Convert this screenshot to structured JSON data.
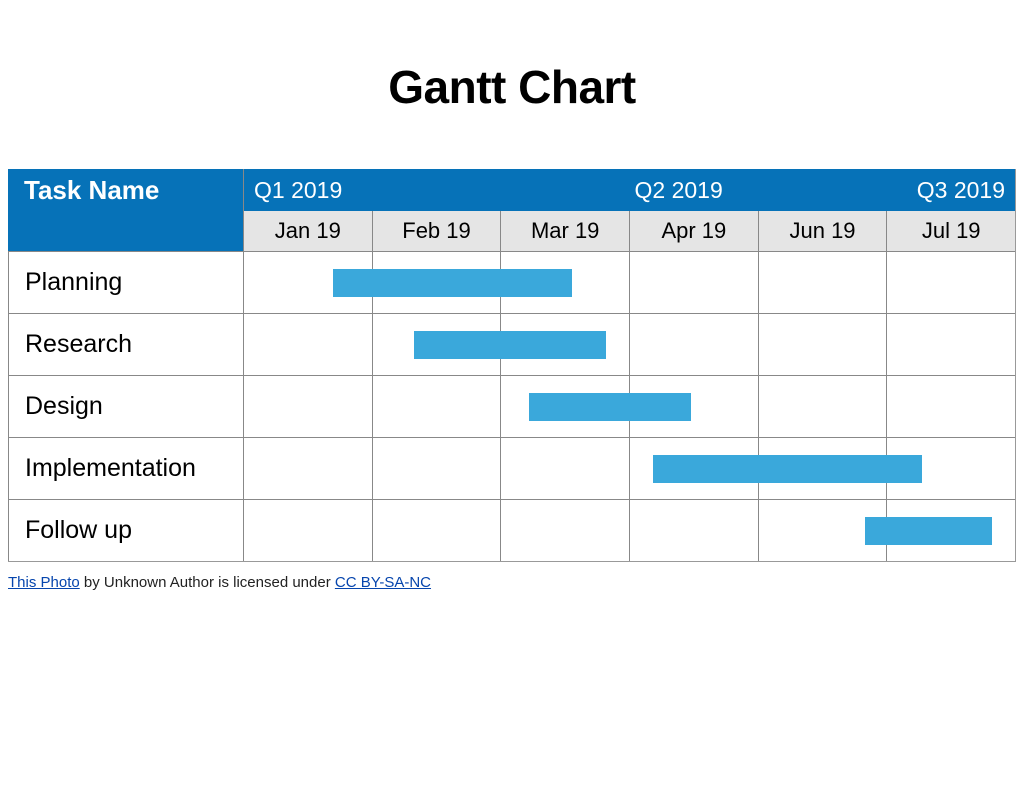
{
  "title": "Gantt Chart",
  "task_header": "Task Name",
  "quarters": [
    "Q1 2019",
    "Q2 2019",
    "Q3 2019"
  ],
  "months": [
    "Jan 19",
    "Feb 19",
    "Mar 19",
    "Apr 19",
    "Jun 19",
    "Jul 19"
  ],
  "tasks": [
    {
      "name": "Planning",
      "start_pct": 11.5,
      "width_pct": 31
    },
    {
      "name": "Research",
      "start_pct": 22,
      "width_pct": 25
    },
    {
      "name": "Design",
      "start_pct": 37,
      "width_pct": 21
    },
    {
      "name": "Implementation",
      "start_pct": 53,
      "width_pct": 35
    },
    {
      "name": "Follow up",
      "start_pct": 80.5,
      "width_pct": 16.5
    }
  ],
  "attribution": {
    "prefix_link": "This Photo",
    "mid_text": " by Unknown Author is licensed under ",
    "license_link": "CC BY-SA-NC"
  },
  "chart_data": {
    "type": "gantt",
    "title": "Gantt Chart",
    "time_axis_columns": [
      "Jan 19",
      "Feb 19",
      "Mar 19",
      "Apr 19",
      "Jun 19",
      "Jul 19"
    ],
    "quarter_groupings": {
      "Q1 2019": [
        "Jan 19",
        "Feb 19",
        "Mar 19"
      ],
      "Q2 2019": [
        "Apr 19",
        "Jun 19"
      ],
      "Q3 2019": [
        "Jul 19"
      ]
    },
    "tasks": [
      {
        "name": "Planning",
        "start_month": "Jan 19",
        "start_fraction": 0.7,
        "end_month": "Mar 19",
        "end_fraction": 0.55
      },
      {
        "name": "Research",
        "start_month": "Feb 19",
        "start_fraction": 0.3,
        "end_month": "Mar 19",
        "end_fraction": 0.8
      },
      {
        "name": "Design",
        "start_month": "Mar 19",
        "start_fraction": 0.2,
        "end_month": "Apr 19",
        "end_fraction": 0.5
      },
      {
        "name": "Implementation",
        "start_month": "Apr 19",
        "start_fraction": 0.2,
        "end_month": "Jun 19",
        "end_fraction": 1.3
      },
      {
        "name": "Follow up",
        "start_month": "Jun 19",
        "start_fraction": 0.85,
        "end_month": "Jul 19",
        "end_fraction": 0.8
      }
    ]
  }
}
